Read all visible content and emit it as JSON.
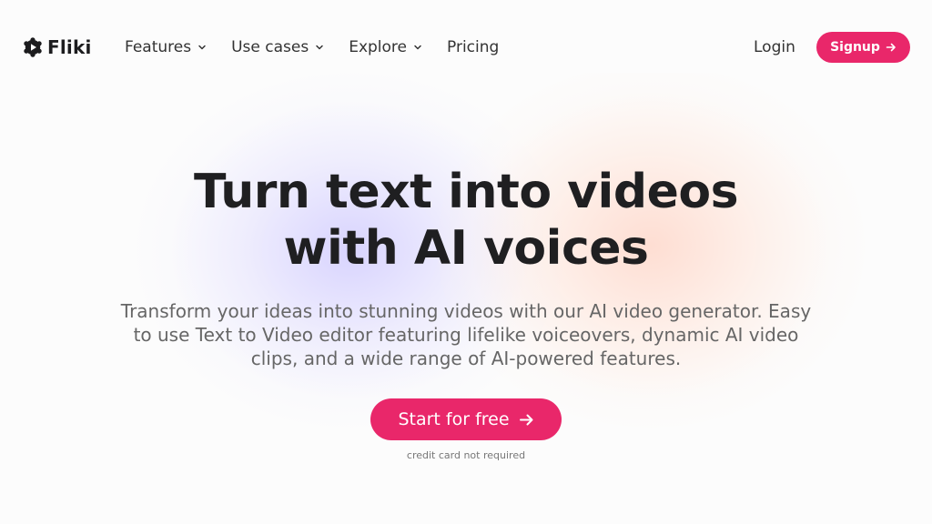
{
  "brand": {
    "name": "Fliki",
    "accent_color": "#e9276a"
  },
  "nav": {
    "items": [
      {
        "label": "Features",
        "icon": "chevron-down-icon"
      },
      {
        "label": "Use cases",
        "icon": "chevron-down-icon"
      },
      {
        "label": "Explore",
        "icon": "chevron-down-icon"
      },
      {
        "label": "Pricing"
      }
    ],
    "login_label": "Login",
    "signup_label": "Signup",
    "signup_icon": "arrow-right-icon"
  },
  "hero": {
    "headline_line1": "Turn text into videos",
    "headline_line2": "with AI voices",
    "subtitle": "Transform your ideas into stunning videos with our AI video generator. Easy to use Text to Video editor featuring lifelike voiceovers, dynamic AI video clips, and a wide range of AI-powered features.",
    "cta_label": "Start for free",
    "cta_icon": "arrow-right-icon",
    "note": "credit card not required"
  }
}
